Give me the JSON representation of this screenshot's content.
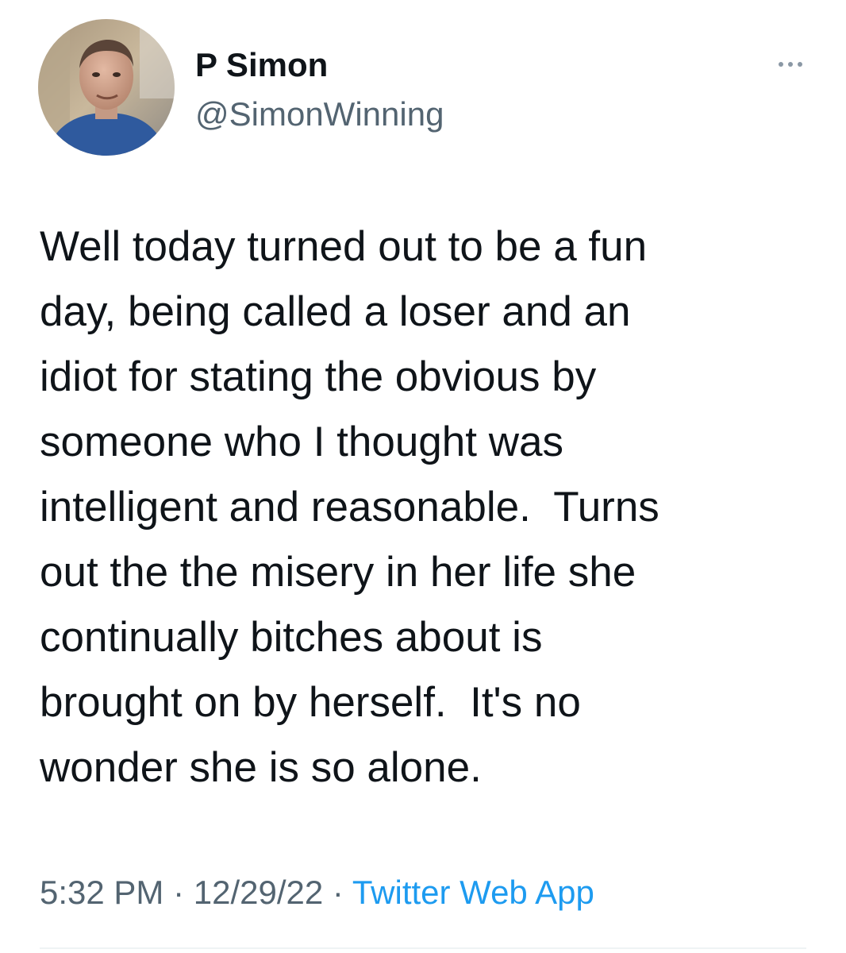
{
  "author": {
    "display_name": "P Simon",
    "handle": "@SimonWinning",
    "avatar_icon": "profile-photo"
  },
  "more_icon": "more-horizontal-icon",
  "tweet": {
    "text": "Well today turned out to be a fun\nday, being called a loser and an\nidiot for stating the obvious by\nsomeone who I thought was\nintelligent and reasonable.  Turns\nout the the misery in her life she\ncontinually bitches about is\nbrought on by herself.  It's no\nwonder she is so alone."
  },
  "meta": {
    "time": "5:32 PM",
    "separator_1": " · ",
    "date": "12/29/22",
    "separator_2": " · ",
    "source": "Twitter Web App"
  },
  "colors": {
    "text_primary": "#0f1419",
    "text_secondary": "#536471",
    "link": "#1d9bf0",
    "divider": "#eff3f4"
  }
}
